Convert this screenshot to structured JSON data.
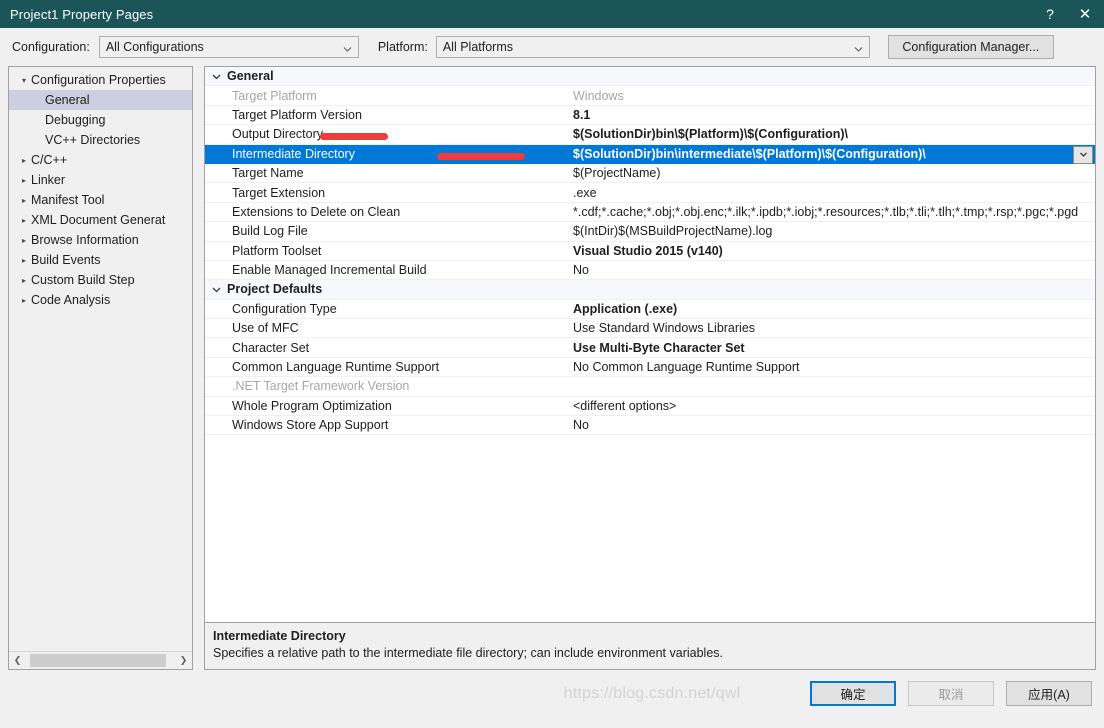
{
  "window": {
    "title": "Project1 Property Pages",
    "help_icon": "help-question-icon",
    "close_icon": "close-icon"
  },
  "configbar": {
    "configuration_label": "Configuration:",
    "configuration_value": "All Configurations",
    "platform_label": "Platform:",
    "platform_value": "All Platforms",
    "config_manager_button": "Configuration Manager..."
  },
  "tree": {
    "nodes": [
      {
        "label": "Configuration Properties",
        "level": 0,
        "arrow": "expanded",
        "selected": false
      },
      {
        "label": "General",
        "level": 1,
        "arrow": "none",
        "selected": true
      },
      {
        "label": "Debugging",
        "level": 1,
        "arrow": "none",
        "selected": false
      },
      {
        "label": "VC++ Directories",
        "level": 1,
        "arrow": "none",
        "selected": false
      },
      {
        "label": "C/C++",
        "level": 1,
        "arrow": "collapsed",
        "selected": false
      },
      {
        "label": "Linker",
        "level": 1,
        "arrow": "collapsed",
        "selected": false
      },
      {
        "label": "Manifest Tool",
        "level": 1,
        "arrow": "collapsed",
        "selected": false
      },
      {
        "label": "XML Document Generat",
        "level": 1,
        "arrow": "collapsed",
        "selected": false
      },
      {
        "label": "Browse Information",
        "level": 1,
        "arrow": "collapsed",
        "selected": false
      },
      {
        "label": "Build Events",
        "level": 1,
        "arrow": "collapsed",
        "selected": false
      },
      {
        "label": "Custom Build Step",
        "level": 1,
        "arrow": "collapsed",
        "selected": false
      },
      {
        "label": "Code Analysis",
        "level": 1,
        "arrow": "collapsed",
        "selected": false
      }
    ],
    "scrollbar": {
      "left_arrow": "chevron-left-icon",
      "right_arrow": "chevron-right-icon"
    }
  },
  "grid": {
    "groups": [
      {
        "name": "General",
        "rows": [
          {
            "name": "Target Platform",
            "value": "Windows",
            "name_dim": true,
            "value_dim": true,
            "value_bold": false,
            "selected": false,
            "redacted": false
          },
          {
            "name": "Target Platform Version",
            "value": "8.1",
            "name_dim": false,
            "value_dim": false,
            "value_bold": true,
            "selected": false,
            "redacted": false
          },
          {
            "name": "Output Directory",
            "value": "$(SolutionDir)bin\\$(Platform)\\$(Configuration)\\",
            "name_dim": false,
            "value_dim": false,
            "value_bold": true,
            "selected": false,
            "redacted": true
          },
          {
            "name": "Intermediate Directory",
            "value": "$(SolutionDir)bin\\intermediate\\$(Platform)\\$(Configuration)\\",
            "name_dim": false,
            "value_dim": false,
            "value_bold": true,
            "selected": true,
            "redacted": true
          },
          {
            "name": "Target Name",
            "value": "$(ProjectName)",
            "name_dim": false,
            "value_dim": false,
            "value_bold": false,
            "selected": false,
            "redacted": false
          },
          {
            "name": "Target Extension",
            "value": ".exe",
            "name_dim": false,
            "value_dim": false,
            "value_bold": false,
            "selected": false,
            "redacted": false
          },
          {
            "name": "Extensions to Delete on Clean",
            "value": "*.cdf;*.cache;*.obj;*.obj.enc;*.ilk;*.ipdb;*.iobj;*.resources;*.tlb;*.tli;*.tlh;*.tmp;*.rsp;*.pgc;*.pgd",
            "name_dim": false,
            "value_dim": false,
            "value_bold": false,
            "selected": false,
            "redacted": false
          },
          {
            "name": "Build Log File",
            "value": "$(IntDir)$(MSBuildProjectName).log",
            "name_dim": false,
            "value_dim": false,
            "value_bold": false,
            "selected": false,
            "redacted": false
          },
          {
            "name": "Platform Toolset",
            "value": "Visual Studio 2015 (v140)",
            "name_dim": false,
            "value_dim": false,
            "value_bold": true,
            "selected": false,
            "redacted": false
          },
          {
            "name": "Enable Managed Incremental Build",
            "value": "No",
            "name_dim": false,
            "value_dim": false,
            "value_bold": false,
            "selected": false,
            "redacted": false
          }
        ]
      },
      {
        "name": "Project Defaults",
        "rows": [
          {
            "name": "Configuration Type",
            "value": "Application (.exe)",
            "name_dim": false,
            "value_dim": false,
            "value_bold": true,
            "selected": false,
            "redacted": false
          },
          {
            "name": "Use of MFC",
            "value": "Use Standard Windows Libraries",
            "name_dim": false,
            "value_dim": false,
            "value_bold": false,
            "selected": false,
            "redacted": false
          },
          {
            "name": "Character Set",
            "value": "Use Multi-Byte Character Set",
            "name_dim": false,
            "value_dim": false,
            "value_bold": true,
            "selected": false,
            "redacted": false
          },
          {
            "name": "Common Language Runtime Support",
            "value": "No Common Language Runtime Support",
            "name_dim": false,
            "value_dim": false,
            "value_bold": false,
            "selected": false,
            "redacted": false
          },
          {
            "name": ".NET Target Framework Version",
            "value": "",
            "name_dim": true,
            "value_dim": true,
            "value_bold": false,
            "selected": false,
            "redacted": false
          },
          {
            "name": "Whole Program Optimization",
            "value": "<different options>",
            "name_dim": false,
            "value_dim": false,
            "value_bold": false,
            "selected": false,
            "redacted": false
          },
          {
            "name": "Windows Store App Support",
            "value": "No",
            "name_dim": false,
            "value_dim": false,
            "value_bold": false,
            "selected": false,
            "redacted": false
          }
        ]
      }
    ]
  },
  "description": {
    "title": "Intermediate Directory",
    "text": "Specifies a relative path to the intermediate file directory; can include environment variables."
  },
  "footer": {
    "ok_label": "确定",
    "cancel_label": "取消",
    "apply_label": "应用(A)",
    "watermark": "https://blog.csdn.net/qwl"
  },
  "colors": {
    "titlebar": "#1c5558",
    "selection": "#0078d7",
    "redaction": "#f03c3c",
    "tree_selection": "#cbcfdf",
    "group_header": "#f6f8fc"
  }
}
